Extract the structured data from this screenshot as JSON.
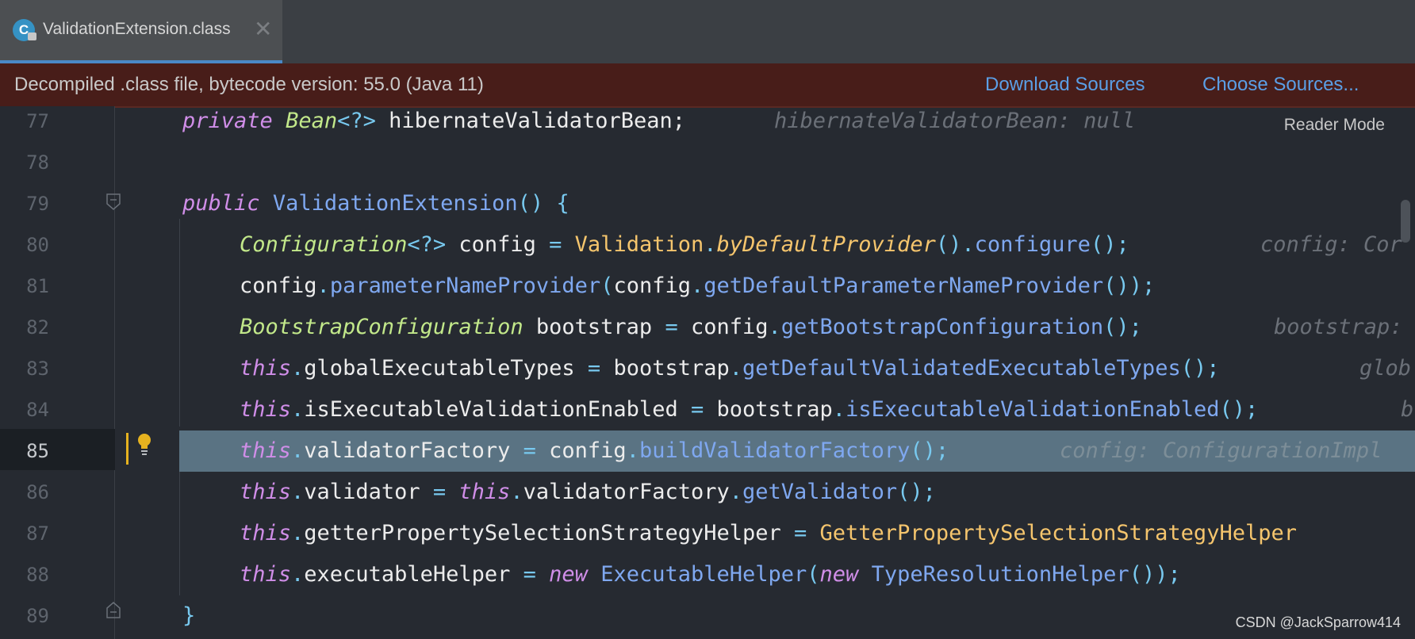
{
  "tab": {
    "icon_letter": "C",
    "title": "ValidationExtension.class",
    "close_glyph": "✕"
  },
  "banner": {
    "message": "Decompiled .class file, bytecode version: 55.0 (Java 11)",
    "download_sources": "Download Sources",
    "choose_sources": "Choose Sources..."
  },
  "editor": {
    "reader_mode": "Reader Mode",
    "line_numbers": [
      "77",
      "78",
      "79",
      "80",
      "81",
      "82",
      "83",
      "84",
      "85",
      "86",
      "87",
      "88",
      "89"
    ],
    "current_line": "85",
    "lines": {
      "l77": {
        "kw": "private",
        "type": "Bean",
        "generic": "<?>",
        "name": " hibernateValidatorBean",
        "semi": ";",
        "hint": "hibernateValidatorBean: null"
      },
      "l79": {
        "kw": "public",
        "ctor": "ValidationExtension",
        "rest": "() {"
      },
      "l80": {
        "type": "Configuration",
        "generic": "<?>",
        "var": " config ",
        "eq": "= ",
        "cls": "Validation",
        "dot": ".",
        "sfn": "byDefaultProvider",
        "p1": "().",
        "fn": "configure",
        "p2": "();",
        "hint": "config: Cor"
      },
      "l81": {
        "var": "config",
        "dot": ".",
        "fn": "parameterNameProvider",
        "p1": "(",
        "var2": "config",
        "dot2": ".",
        "fn2": "getDefaultParameterNameProvider",
        "p2": "());"
      },
      "l82": {
        "type": "BootstrapConfiguration",
        "var": " bootstrap ",
        "eq": "= ",
        "var2": "config",
        "dot": ".",
        "fn": "getBootstrapConfiguration",
        "p": "();",
        "hint": "bootstrap:"
      },
      "l83": {
        "kw": "this",
        "dot": ".",
        "field": "globalExecutableTypes ",
        "eq": "= ",
        "var": "bootstrap",
        "dot2": ".",
        "fn": "getDefaultValidatedExecutableTypes",
        "p": "();",
        "hint": "glob"
      },
      "l84": {
        "kw": "this",
        "dot": ".",
        "field": "isExecutableValidationEnabled ",
        "eq": "= ",
        "var": "bootstrap",
        "dot2": ".",
        "fn": "isExecutableValidationEnabled",
        "p": "();",
        "hint": "b"
      },
      "l85": {
        "kw": "this",
        "dot": ".",
        "field": "validatorFactory ",
        "eq": "= ",
        "var": "config",
        "dot2": ".",
        "fn": "buildValidatorFactory",
        "p": "();",
        "hint": "config: ConfigurationImpl"
      },
      "l86": {
        "kw": "this",
        "dot": ".",
        "field": "validator ",
        "eq": "= ",
        "kw2": "this",
        "dot2": ".",
        "field2": "validatorFactory",
        "dot3": ".",
        "fn": "getValidator",
        "p": "();"
      },
      "l87": {
        "kw": "this",
        "dot": ".",
        "field": "getterPropertySelectionStrategyHelper ",
        "eq": "= ",
        "cls": "GetterPropertySelectionStrategyHelper"
      },
      "l88": {
        "kw": "this",
        "dot": ".",
        "field": "executableHelper ",
        "eq": "= ",
        "kw2": "new",
        "cls": " ExecutableHelper",
        "p1": "(",
        "kw3": "new",
        "cls2": " TypeResolutionHelper",
        "p2": "());"
      },
      "l89": {
        "brace": "}"
      }
    }
  },
  "watermark": "CSDN @JackSparrow414",
  "colors": {
    "banner_bg": "#481d19",
    "link": "#5b9fe6",
    "highlight_line": "#5a7383",
    "bulb": "#e6b21f"
  }
}
